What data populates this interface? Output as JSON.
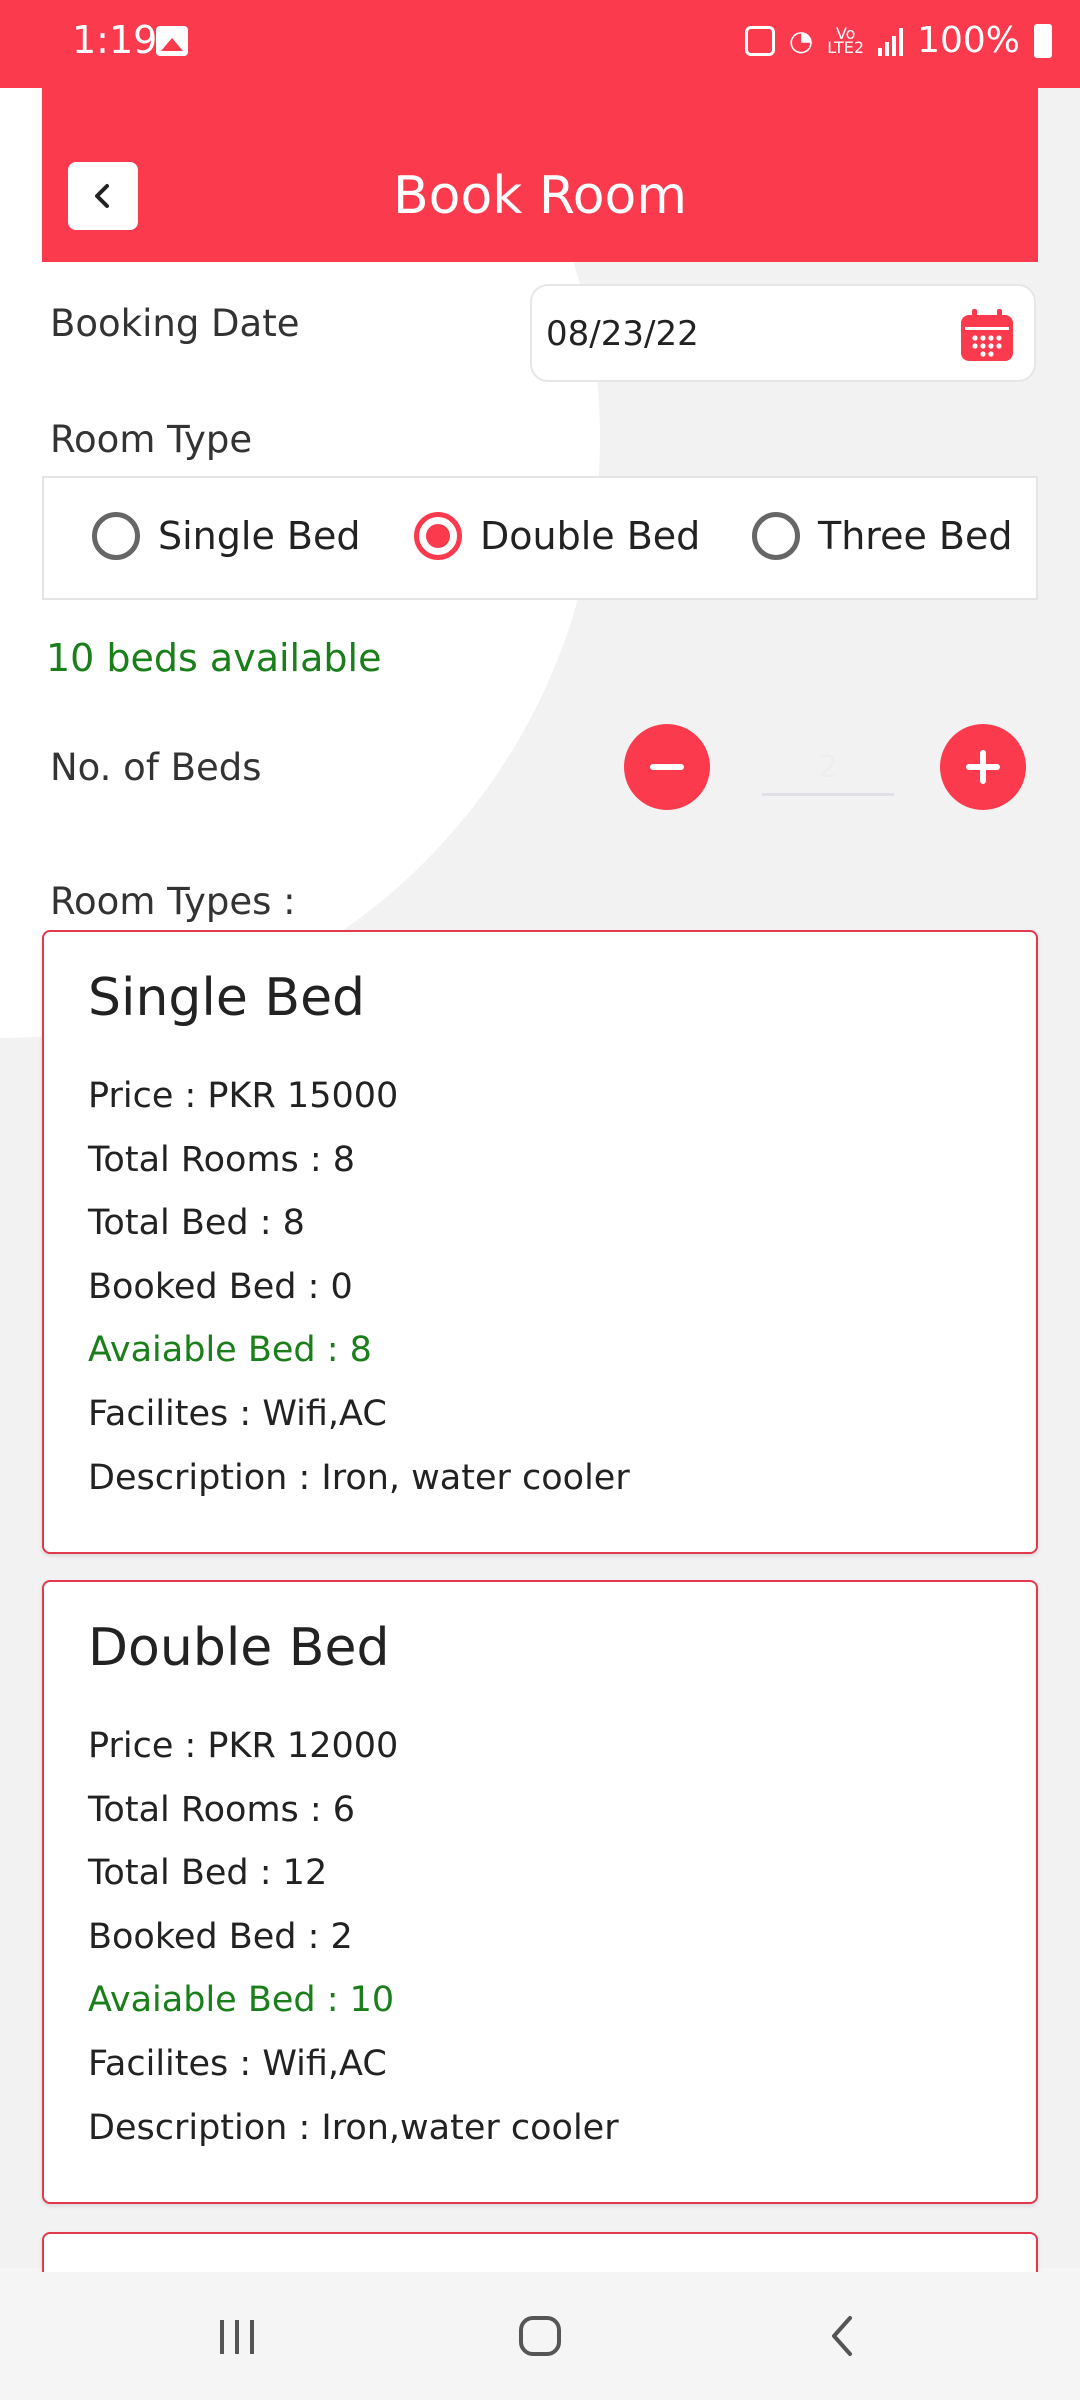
{
  "status_bar": {
    "time": "1:19",
    "battery": "100%"
  },
  "app_bar": {
    "title": "Book Room"
  },
  "booking_date": {
    "label": "Booking Date",
    "value": "08/23/22"
  },
  "room_type": {
    "label": "Room Type",
    "options": [
      "Single Bed",
      "Double Bed",
      "Three Bed"
    ],
    "selected": "Double Bed"
  },
  "availability_text": "10 beds available",
  "beds": {
    "label": "No. of Beds",
    "value": "2"
  },
  "room_types_heading": "Room Types :",
  "cards": [
    {
      "title": "Single Bed",
      "price": "Price : PKR 15000",
      "total_rooms": "Total Rooms : 8",
      "total_bed": "Total Bed : 8",
      "booked_bed": "Booked Bed : 0",
      "available_bed": "Avaiable Bed : 8",
      "facilities": "Facilites : Wifi,AC",
      "description": "Description : Iron, water cooler"
    },
    {
      "title": "Double Bed",
      "price": "Price : PKR 12000",
      "total_rooms": "Total Rooms : 6",
      "total_bed": "Total Bed : 12",
      "booked_bed": "Booked Bed : 2",
      "available_bed": "Avaiable Bed : 10",
      "facilities": "Facilites : Wifi,AC",
      "description": "Description : Iron,water cooler"
    }
  ],
  "colors": {
    "accent": "#fb3a4e",
    "available": "#1a7f1a"
  }
}
